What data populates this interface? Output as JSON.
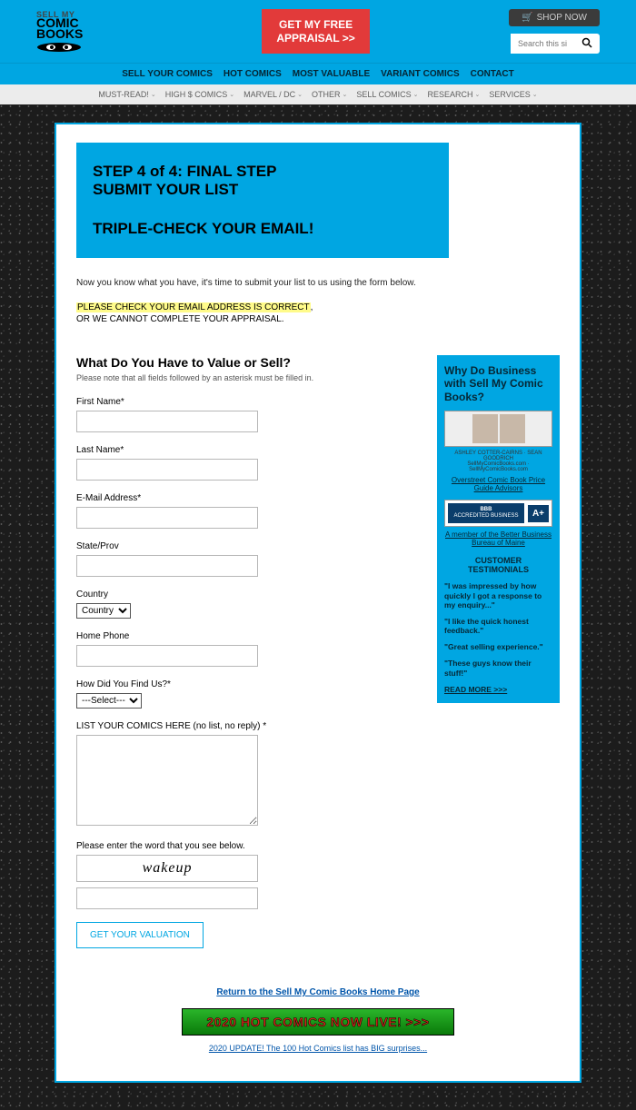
{
  "header": {
    "logo_line1": "SELL MY",
    "logo_line2": "COMIC",
    "logo_line3": "BOOKS",
    "cta_line1": "GET MY FREE",
    "cta_line2": "APPRAISAL >>",
    "shop_now": "SHOP NOW",
    "search_placeholder": "Search this site..."
  },
  "nav1": [
    "SELL YOUR COMICS",
    "HOT COMICS",
    "MOST VALUABLE",
    "VARIANT COMICS",
    "CONTACT"
  ],
  "nav2": [
    "MUST-READ!",
    "HIGH $ COMICS",
    "MARVEL / DC",
    "OTHER",
    "SELL COMICS",
    "RESEARCH",
    "SERVICES"
  ],
  "hero": {
    "l1": "STEP 4 of 4: FINAL STEP",
    "l2": "SUBMIT YOUR LIST",
    "l3": "TRIPLE-CHECK YOUR EMAIL!"
  },
  "intro": "Now you know what you have, it's time to submit your list to us using the form below.",
  "warn1_hl": "PLEASE CHECK YOUR EMAIL ADDRESS IS CORRECT",
  "warn1_tail": ",",
  "warn2": "OR WE CANNOT COMPLETE YOUR APPRAISAL.",
  "form": {
    "heading": "What Do You Have to Value or Sell?",
    "note": "Please note that all fields followed by an asterisk must be filled in.",
    "first_name": "First Name*",
    "last_name": "Last Name*",
    "email": "E-Mail Address*",
    "state": "State/Prov",
    "country": "Country",
    "country_default": "Country",
    "home_phone": "Home Phone",
    "how_found": "How Did You Find Us?*",
    "how_found_default": "---Select---",
    "list_label": "LIST YOUR COMICS HERE (no list, no reply) *",
    "captcha_label": "Please enter the word that you see below.",
    "captcha_word": "wakeup",
    "submit": "GET YOUR VALUATION"
  },
  "sidebar": {
    "heading": "Why Do Business with Sell My Comic Books?",
    "advisor_caption": "Overstreet Comic Book Price Guide Advisors",
    "bbb_text": "ACCREDITED BUSINESS",
    "bbb_grade": "A+",
    "bbb_caption": "A member of the Better Business Bureau of Maine",
    "test_head": "CUSTOMER TESTIMONIALS",
    "t1": "\"I was impressed by how quickly I got a response to my enquiry...\"",
    "t2": "\"I like the quick honest feedback.\"",
    "t3": "\"Great selling experience.\"",
    "t4": "\"These guys know their stuff!\"",
    "readmore": "READ MORE >>>"
  },
  "footer": {
    "return": "Return to the Sell My Comic Books Home Page",
    "banner": "2020 HOT COMICS NOW LIVE! >>>",
    "banner_sub": "2020 UPDATE! The 100 Hot Comics list has BIG surprises..."
  }
}
